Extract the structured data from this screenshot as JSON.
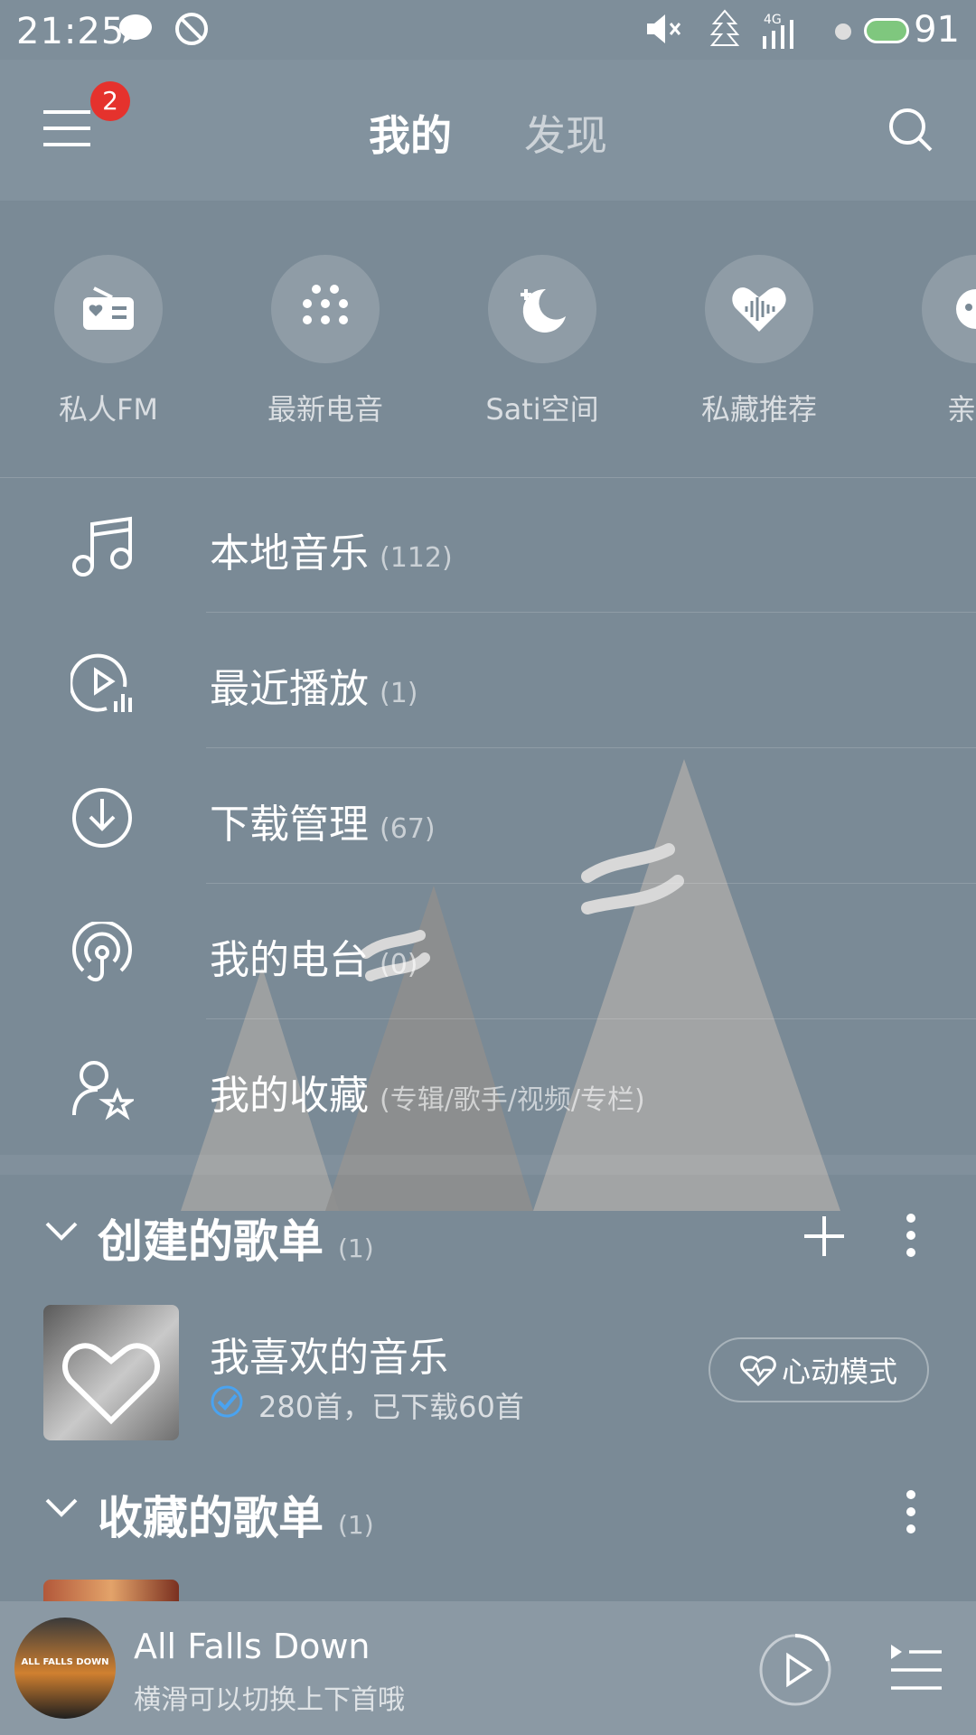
{
  "status_bar": {
    "time": "21:25",
    "network": "4G",
    "battery": "91"
  },
  "header": {
    "tabs": [
      {
        "label": "我的",
        "active": true
      },
      {
        "label": "发现",
        "active": false
      }
    ],
    "menu_badge": "2"
  },
  "quick_access": [
    {
      "label": "私人FM",
      "icon": "radio-icon"
    },
    {
      "label": "最新电音",
      "icon": "dots-grid-icon"
    },
    {
      "label": "Sati空间",
      "icon": "moon-icon"
    },
    {
      "label": "私藏推荐",
      "icon": "heart-wave-icon"
    },
    {
      "label": "亲子",
      "icon": "kids-icon"
    }
  ],
  "menu": [
    {
      "label": "本地音乐",
      "count": "(112)",
      "icon": "music-note-icon"
    },
    {
      "label": "最近播放",
      "count": "(1)",
      "icon": "recent-play-icon"
    },
    {
      "label": "下载管理",
      "count": "(67)",
      "icon": "download-icon"
    },
    {
      "label": "我的电台",
      "count": "(0)",
      "icon": "podcast-icon"
    },
    {
      "label": "我的收藏",
      "count": "(专辑/歌手/视频/专栏)",
      "icon": "user-star-icon"
    }
  ],
  "created_playlists": {
    "title": "创建的歌单",
    "count": "(1)",
    "items": [
      {
        "name": "我喜欢的音乐",
        "meta": "280首，已下载60首",
        "mode_button": "心动模式"
      }
    ]
  },
  "collected_playlists": {
    "title": "收藏的歌单",
    "count": "(1)"
  },
  "now_playing": {
    "title": "All Falls Down",
    "subtitle": "横滑可以切换上下首哦",
    "cover_text": "ALL FALLS DOWN"
  },
  "colors": {
    "background": "#7a8a96",
    "badge": "#e5322d",
    "check": "#4aa3f0"
  }
}
